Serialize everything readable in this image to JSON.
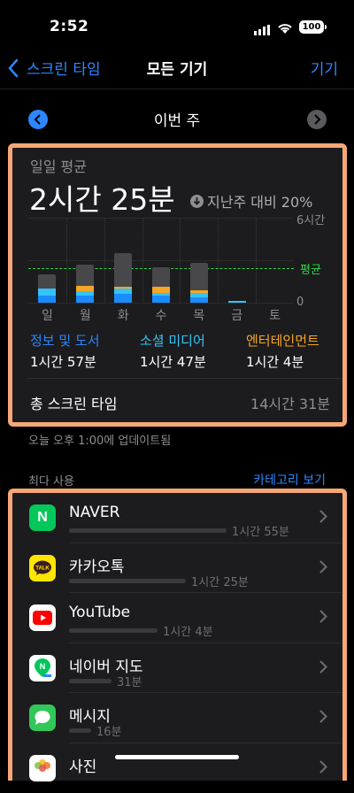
{
  "status": {
    "time": "2:52",
    "battery": "100"
  },
  "nav": {
    "back_label": "스크린 타임",
    "title": "모든 기기",
    "right_label": "기기"
  },
  "week": {
    "label": "이번 주"
  },
  "summary": {
    "avg_label": "일일 평균",
    "avg_value": "2시간 25분",
    "compare": "지난주 대비 20%",
    "axis_max": "6시간",
    "axis_min": "0",
    "avg_line_label": "평균",
    "total_label": "총 스크린 타임",
    "total_value": "14시간 31분"
  },
  "chart_data": {
    "type": "bar",
    "categories": [
      "일",
      "월",
      "화",
      "수",
      "목",
      "금",
      "토"
    ],
    "ylim": [
      0,
      6
    ],
    "y_unit": "시간",
    "average": 2.42,
    "totals": [
      2.0,
      2.7,
      3.5,
      2.5,
      2.8,
      0.1,
      0
    ],
    "series": [
      {
        "name": "정보 및 도서",
        "color": "#1b8cff",
        "values": [
          0.5,
          0.5,
          0.6,
          0.5,
          0.4,
          0,
          0
        ]
      },
      {
        "name": "소셜 미디어",
        "color": "#35c2f5",
        "values": [
          0.5,
          0.3,
          0.4,
          0.2,
          0.3,
          0.1,
          0
        ]
      },
      {
        "name": "엔터테인먼트",
        "color": "#f5a623",
        "values": [
          0,
          0.4,
          0.1,
          0.4,
          0.2,
          0,
          0
        ]
      }
    ]
  },
  "categories": [
    {
      "name": "정보 및 도서",
      "time": "1시간 57분",
      "color": "#2e86ff"
    },
    {
      "name": "소셜 미디어",
      "time": "1시간 47분",
      "color": "#35c2f5"
    },
    {
      "name": "엔터테인먼트",
      "time": "1시간 4분",
      "color": "#f5a623"
    }
  ],
  "updated": "오늘 오후 1:00에 업데이트됨",
  "most_used": {
    "header": "최다 사용",
    "link": "카테고리 보기",
    "apps": [
      {
        "name": "NAVER",
        "time": "1시간 55분",
        "fraction": 1.0,
        "icon": "naver-icon"
      },
      {
        "name": "카카오톡",
        "time": "1시간 25분",
        "fraction": 0.74,
        "icon": "kakaotalk-icon"
      },
      {
        "name": "YouTube",
        "time": "1시간 4분",
        "fraction": 0.56,
        "icon": "youtube-icon"
      },
      {
        "name": "네이버 지도",
        "time": "31분",
        "fraction": 0.27,
        "icon": "naver-map-icon"
      },
      {
        "name": "메시지",
        "time": "16분",
        "fraction": 0.14,
        "icon": "messages-icon"
      },
      {
        "name": "사진",
        "time": "",
        "fraction": 0,
        "icon": "photos-icon"
      }
    ]
  }
}
